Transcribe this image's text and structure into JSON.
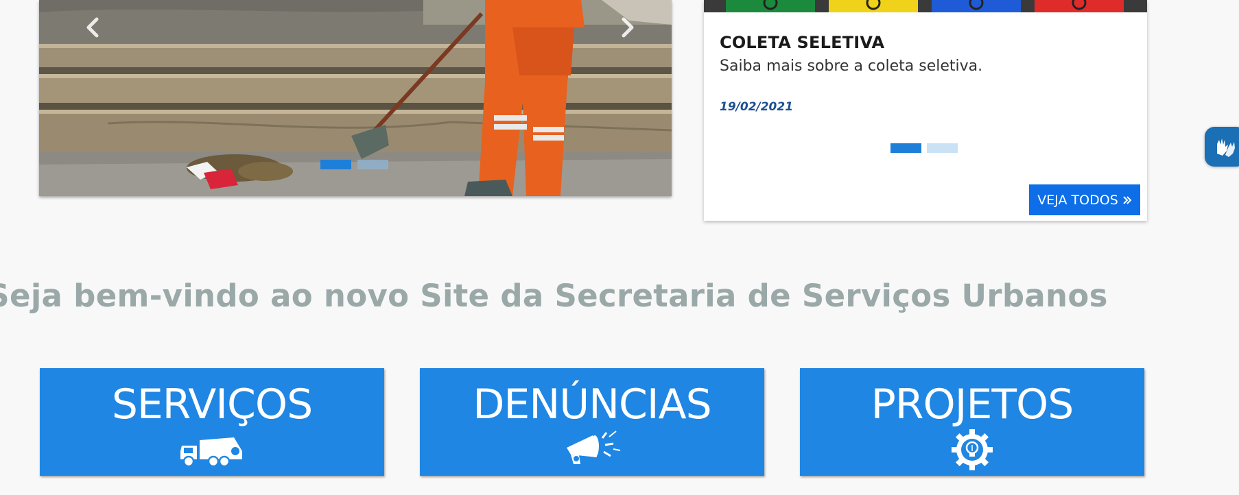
{
  "carousel": {
    "prev_icon": "chevron-left-icon",
    "next_icon": "chevron-right-icon",
    "slide_count": 2,
    "active_slide": 1
  },
  "news": {
    "title": "COLETA SELETIVA",
    "description": "Saiba mais sobre a coleta seletiva.",
    "date": "19/02/2021",
    "button_label": "VEJA TODOS",
    "button_icon": "double-chevron-right-icon",
    "active_slide": 1,
    "slide_count": 2
  },
  "welcome": {
    "heading": "Seja bem-vindo ao novo Site da Secretaria de Serviços Urbanos"
  },
  "tiles": [
    {
      "label": "SERVIÇOS",
      "icon": "garbage-truck-icon"
    },
    {
      "label": "DENÚNCIAS",
      "icon": "megaphone-icon"
    },
    {
      "label": "PROJETOS",
      "icon": "gear-lightbulb-icon"
    }
  ],
  "accessibility": {
    "icon": "sign-language-hands-icon"
  },
  "colors": {
    "tile_blue": "#1f86e3",
    "button_blue": "#0d6ee8",
    "date_blue": "#1d4f91",
    "heading_gray": "#9aa8a8",
    "uniform_orange": "#e8611e"
  }
}
